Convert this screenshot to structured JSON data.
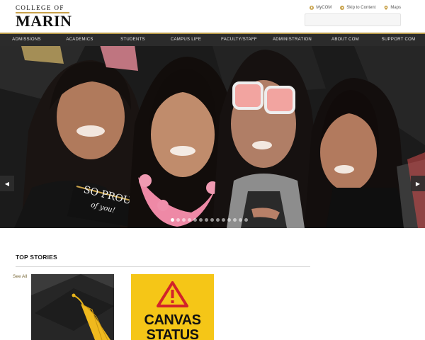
{
  "logo": {
    "top_line": "COLLEGE OF",
    "main": "MARIN"
  },
  "utility": {
    "links": [
      {
        "label": "MyCOM",
        "icon": "user-icon"
      },
      {
        "label": "Skip to Content",
        "icon": "arrow-right-circle-icon"
      },
      {
        "label": "Maps",
        "icon": "map-pin-icon"
      }
    ],
    "search_placeholder": ""
  },
  "nav": {
    "items": [
      "ADMISSIONS",
      "ACADEMICS",
      "STUDENTS",
      "CAMPUS LIFE",
      "FACULTY/STAFF",
      "ADMINISTRATION",
      "ABOUT COM",
      "SUPPORT COM"
    ]
  },
  "hero": {
    "sign_text": "SO PROUD of you!",
    "slide_count": 14,
    "active_slide": 1,
    "prev_label": "◀",
    "next_label": "▶"
  },
  "top_stories": {
    "title": "TOP STORIES",
    "see_all": "See All",
    "cards": [
      {
        "image": "graduation-cap-tassel"
      },
      {
        "image": "canvas-status-warning",
        "lines": [
          "CANVAS",
          "STATUS"
        ]
      }
    ]
  },
  "colors": {
    "gold": "#b99a48",
    "nav_bg": "#2b2b2b",
    "canvas_yellow": "#f5c617",
    "warning_red": "#d2232a"
  }
}
